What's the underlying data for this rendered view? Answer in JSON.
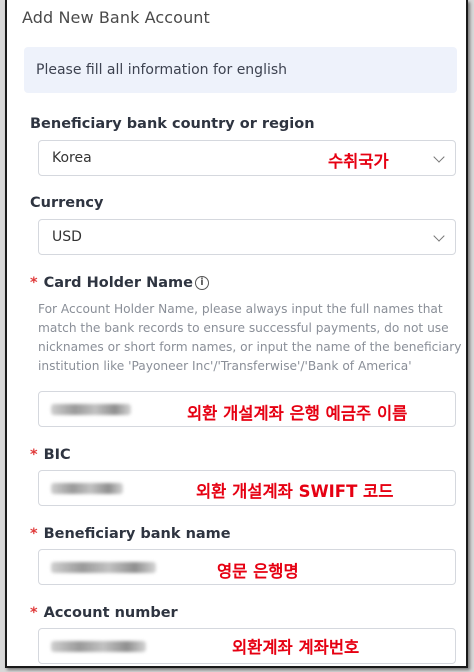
{
  "dialog": {
    "title": "Add New Bank Account",
    "notice": "Please fill all information for english"
  },
  "fields": {
    "country": {
      "label": "Beneficiary bank country or region",
      "value": "Korea",
      "annotation": "수취국가"
    },
    "currency": {
      "label": "Currency",
      "value": "USD"
    },
    "holder": {
      "required_mark": "*",
      "label": "Card Holder Name",
      "helper": "For Account Holder Name, please always input the full names that match the bank records to ensure successful payments, do not use nicknames or short form names, or input the name of the beneficiary institution like 'Payoneer Inc'/'Transferwise'/'Bank of America'",
      "annotation": "외환 개설계좌 은행 예금주 이름"
    },
    "bic": {
      "required_mark": "*",
      "label": "BIC",
      "annotation": "외환 개설계좌 SWIFT 코드"
    },
    "bank_name": {
      "required_mark": "*",
      "label": "Beneficiary bank name",
      "annotation": "영문 은행명"
    },
    "account_number": {
      "required_mark": "*",
      "label": "Account number",
      "annotation": "외환계좌 계좌번호"
    }
  },
  "colors": {
    "annotation": "#e60012",
    "required": "#e03a3a",
    "notice_bg": "#eef2fb"
  }
}
